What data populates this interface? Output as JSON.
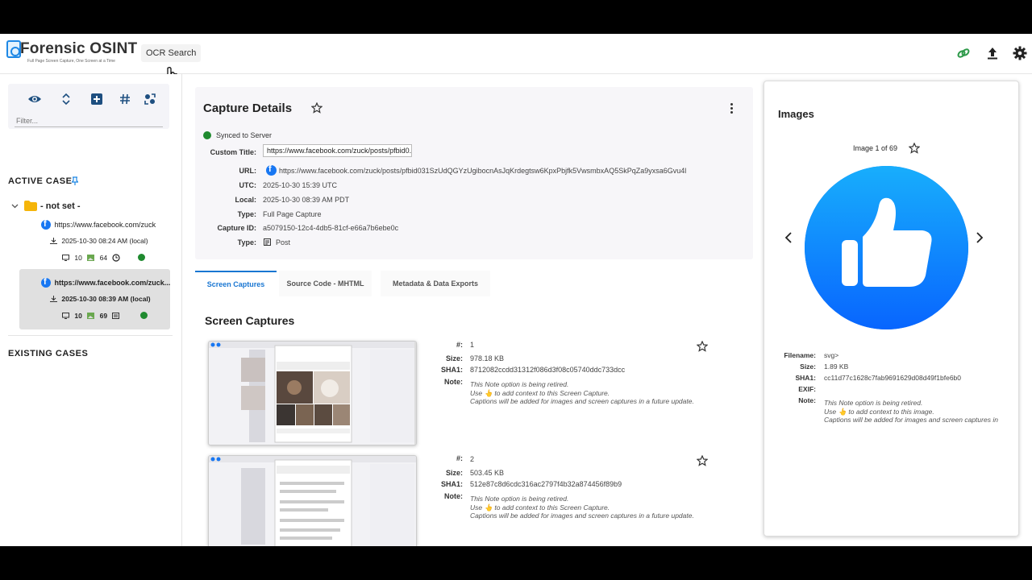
{
  "header": {
    "app_title": "Forensic OSINT",
    "app_subtitle": "Full Page Screen Capture, One Screen at a Time",
    "ocr_button": "OCR Search",
    "icons": [
      "link-icon",
      "upload-icon",
      "gear-icon"
    ],
    "accent_color": "#2e9a4a"
  },
  "sidebar": {
    "toolbar_icons": [
      "eye-icon",
      "expand-collapse-icon",
      "add-box-icon",
      "hash-icon",
      "compare-icon"
    ],
    "filter_placeholder": "Filter...",
    "active_case_label": "ACTIVE CASE",
    "case_name": "- not set -",
    "captures": [
      {
        "url": "https://www.facebook.com/zuck",
        "timestamp": "2025-10-30 08:24 AM (local)",
        "screens": "10",
        "images": "64"
      },
      {
        "url": "https://www.facebook.com/zuck...",
        "timestamp": "2025-10-30 08:39 AM (local)",
        "screens": "10",
        "images": "69"
      }
    ],
    "existing_cases_label": "EXISTING CASES"
  },
  "details": {
    "title": "Capture Details",
    "sync_status": "Synced to Server",
    "custom_title_label": "Custom Title:",
    "custom_title_value": "https://www.facebook.com/zuck/posts/pfbid0...",
    "url_label": "URL:",
    "url_value": "https://www.facebook.com/zuck/posts/pfbid031SzUdQGYzUgibocnAsJqKrdegtsw6KpxPbjfk5VwsmbxAQ5SkPqZa9yxsa6Gvu4l",
    "utc_label": "UTC:",
    "utc_value": "2025-10-30 15:39 UTC",
    "local_label": "Local:",
    "local_value": "2025-10-30 08:39 AM PDT",
    "type_label": "Type:",
    "type_value": "Full Page Capture",
    "capture_id_label": "Capture ID:",
    "capture_id_value": "a5079150-12c4-4db5-81cf-e66a7b6ebe0c",
    "type2_label": "Type:",
    "type2_value": "Post"
  },
  "tabs": [
    {
      "label": "Screen Captures",
      "active": true
    },
    {
      "label": "Source Code - MHTML",
      "active": false
    },
    {
      "label": "Metadata & Data Exports",
      "active": false
    }
  ],
  "screen_captures": {
    "section_title": "Screen Captures",
    "num_label": "#:",
    "size_label": "Size:",
    "sha1_label": "SHA1:",
    "note_label": "Note:",
    "note_lines": [
      "This Note option is being retired.",
      "Use 👆 to add context to this Screen Capture.",
      "Captions will be added for images and screen captures in a future update."
    ],
    "items": [
      {
        "number": "1",
        "size": "978.18 KB",
        "sha1": "8712082ccdd31312f086d3f08c05740ddc733dcc"
      },
      {
        "number": "2",
        "size": "503.45 KB",
        "sha1": "512e87c8d6cdc316ac2797f4b32a874456f89b9"
      }
    ]
  },
  "images_panel": {
    "title": "Images",
    "counter": "Image 1 of 69",
    "filename_label": "Filename:",
    "filename_value": "svg>",
    "size_label": "Size:",
    "size_value": "1.89 KB",
    "sha1_label": "SHA1:",
    "sha1_value": "cc11d77c1628c7fab9691629d08d49f1bfe6b0",
    "exif_label": "EXIF:",
    "note_label": "Note:",
    "note_lines": [
      "This Note option is being retired.",
      "Use 👆 to add context to this image.",
      "Captions will be added for images and screen captures in"
    ]
  }
}
